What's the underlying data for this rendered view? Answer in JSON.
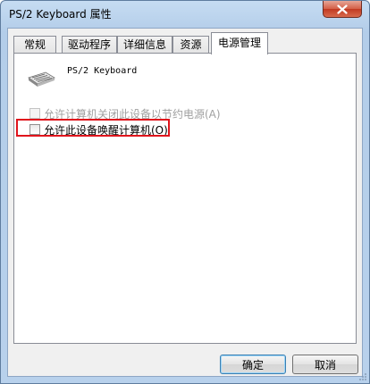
{
  "window": {
    "title": "PS/2 Keyboard 属性",
    "close_label": "×"
  },
  "tabs": [
    {
      "label": "常规"
    },
    {
      "label": "驱动程序"
    },
    {
      "label": "详细信息"
    },
    {
      "label": "资源"
    },
    {
      "label": "电源管理",
      "selected": true
    }
  ],
  "device": {
    "icon": "keyboard-icon",
    "name": "PS/2 Keyboard"
  },
  "options": {
    "power_off": {
      "label": "允许计算机关闭此设备以节约电源(A)",
      "checked": false,
      "enabled": false
    },
    "wake": {
      "label": "允许此设备唤醒计算机(O)",
      "checked": false,
      "enabled": true,
      "highlighted": true
    }
  },
  "buttons": {
    "ok": "确定",
    "cancel": "取消"
  },
  "colors": {
    "highlight": "#e0141c",
    "close_button": "#c13a22",
    "frame": "#b8d1ec"
  }
}
